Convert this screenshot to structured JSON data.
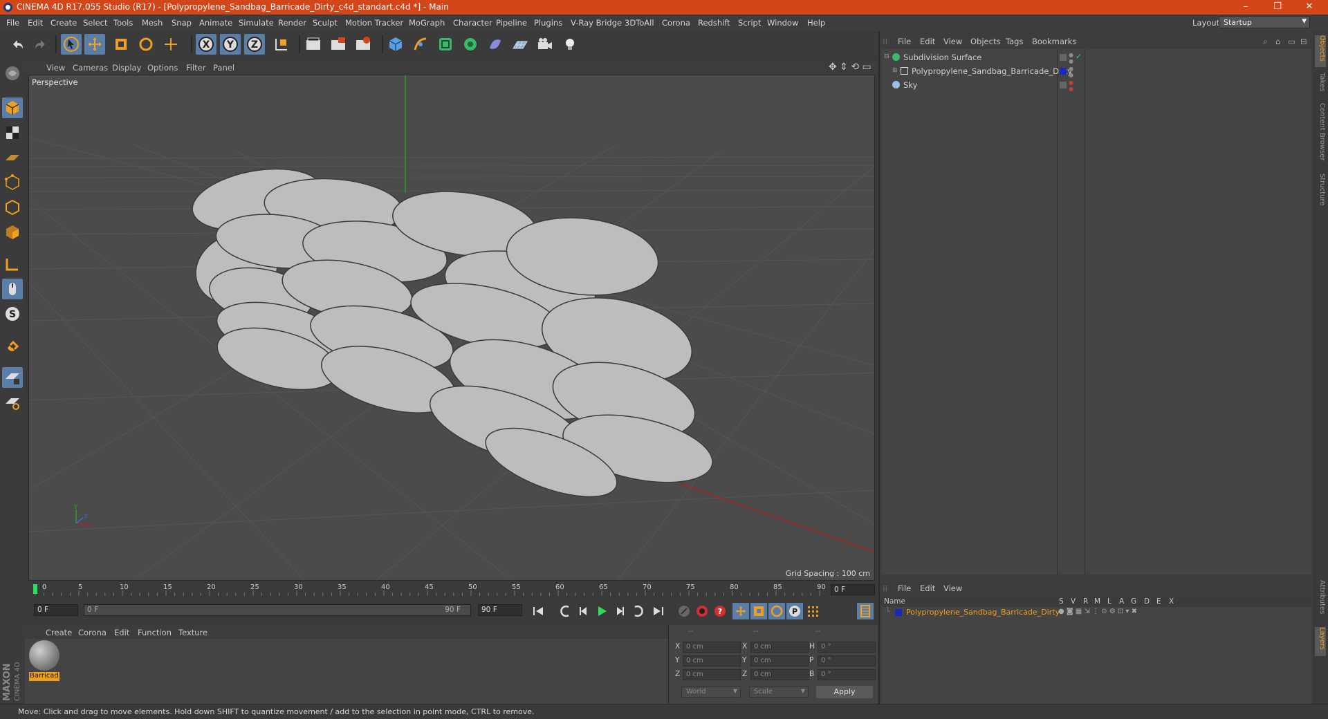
{
  "window": {
    "title": "CINEMA 4D R17.055 Studio (R17) - [Polypropylene_Sandbag_Barricade_Dirty_c4d_standart.c4d *] - Main",
    "minimize": "–",
    "restore": "❐",
    "close": "✕"
  },
  "menubar": {
    "items": [
      "File",
      "Edit",
      "Create",
      "Select",
      "Tools",
      "Mesh",
      "Snap",
      "Animate",
      "Simulate",
      "Render",
      "Sculpt",
      "Motion Tracker",
      "MoGraph",
      "Character",
      "Pipeline",
      "Plugins",
      "V-Ray Bridge",
      "3DToAll",
      "Corona",
      "Redshift",
      "Script",
      "Window",
      "Help"
    ],
    "layout_label": "Layout:",
    "layout_value": "Startup"
  },
  "toolbar": {
    "icons": [
      "undo-icon",
      "redo-icon",
      "select-arrow-icon",
      "move-icon",
      "scale-icon",
      "rotate-icon",
      "add-icon",
      "x-axis-icon",
      "y-axis-icon",
      "z-axis-icon",
      "coord-system-icon",
      "render-view-icon",
      "render-picture-viewer-icon",
      "render-settings-icon",
      "cube-icon",
      "pen-icon",
      "subdivision-icon",
      "mograph-cloner-icon",
      "deformer-icon",
      "floor-icon",
      "camera-icon",
      "light-icon"
    ],
    "axis_labels": [
      "X",
      "Y",
      "Z"
    ]
  },
  "viewport": {
    "menu": [
      "View",
      "Cameras",
      "Display",
      "Options",
      "Filter",
      "Panel"
    ],
    "label": "Perspective",
    "grid_spacing": "Grid Spacing : 100 cm",
    "axis_x": "x",
    "axis_y": "y",
    "axis_z": "z"
  },
  "timeline": {
    "ticks": [
      "0",
      "5",
      "10",
      "15",
      "20",
      "25",
      "30",
      "35",
      "40",
      "45",
      "50",
      "55",
      "60",
      "65",
      "70",
      "75",
      "80",
      "85",
      "90"
    ],
    "end_field": "0 F",
    "current_frame": "0 F",
    "range_start": "0 F",
    "range_end": "90 F",
    "end_frame": "90 F"
  },
  "material_panel": {
    "menu": [
      "Create",
      "Corona",
      "Edit",
      "Function",
      "Texture"
    ],
    "material_name": "Barricad"
  },
  "coordinates": {
    "headers": [
      "--",
      "--",
      "--"
    ],
    "rows": [
      {
        "l1": "X",
        "v1": "0 cm",
        "l2": "X",
        "v2": "0 cm",
        "l3": "H",
        "v3": "0 °"
      },
      {
        "l1": "Y",
        "v1": "0 cm",
        "l2": "Y",
        "v2": "0 cm",
        "l3": "P",
        "v3": "0 °"
      },
      {
        "l1": "Z",
        "v1": "0 cm",
        "l2": "Z",
        "v2": "0 cm",
        "l3": "B",
        "v3": "0 °"
      }
    ],
    "mode_world": "World",
    "mode_scale": "Scale",
    "apply": "Apply"
  },
  "status": "Move: Click and drag to move elements. Hold down SHIFT to quantize movement / add to the selection in point mode, CTRL to remove.",
  "logo": {
    "line1": "MAXON",
    "line2": "CINEMA 4D"
  },
  "object_manager": {
    "menu": [
      "File",
      "Edit",
      "View",
      "Objects",
      "Tags",
      "Bookmarks"
    ],
    "objects": [
      {
        "name": "Subdivision Surface",
        "icon": "subdivision-icon"
      },
      {
        "name": "Polypropylene_Sandbag_Barricade_Dirty",
        "icon": "polygon-object-icon"
      },
      {
        "name": "Sky",
        "icon": "sky-icon"
      }
    ]
  },
  "layer_manager": {
    "menu": [
      "File",
      "Edit",
      "View"
    ],
    "columns": [
      "Name",
      "S",
      "V",
      "R",
      "M",
      "L",
      "A",
      "G",
      "D",
      "E",
      "X"
    ],
    "layer_name": "Polypropylene_Sandbag_Barricade_Dirty"
  },
  "side_tabs": [
    "Objects",
    "Takes",
    "Content Browser",
    "Structure",
    "Attributes",
    "Layers"
  ],
  "colors": {
    "titlebar": "#d2461a",
    "accent": "#f0a020",
    "selection": "#5a7ea8",
    "layer": "#1a2ab8"
  }
}
